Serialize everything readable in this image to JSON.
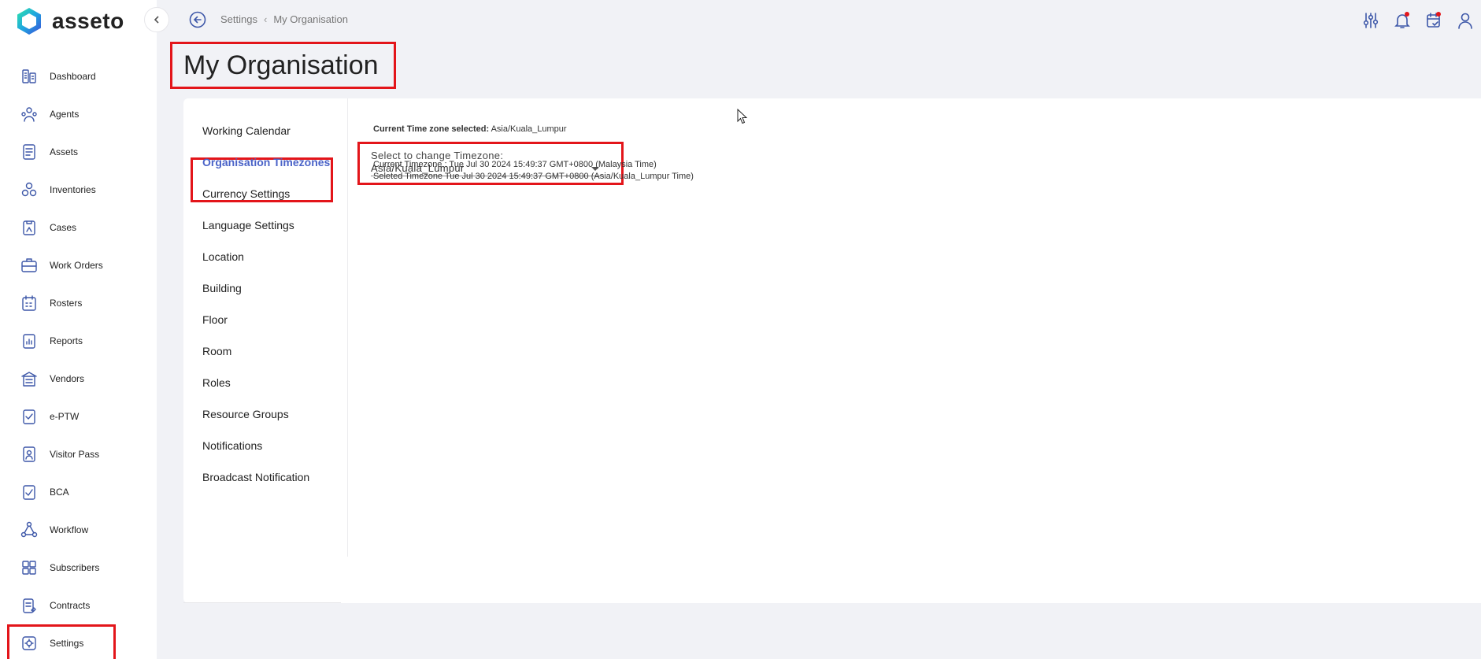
{
  "app": {
    "logo_text": "asseto",
    "brand_color": "#3d57a8",
    "highlight_color": "#e3151a"
  },
  "sidebar": {
    "items": [
      {
        "label": "Dashboard",
        "icon": "dashboard-icon"
      },
      {
        "label": "Agents",
        "icon": "agents-icon"
      },
      {
        "label": "Assets",
        "icon": "assets-icon"
      },
      {
        "label": "Inventories",
        "icon": "inventories-icon"
      },
      {
        "label": "Cases",
        "icon": "cases-icon"
      },
      {
        "label": "Work Orders",
        "icon": "work-orders-icon"
      },
      {
        "label": "Rosters",
        "icon": "rosters-icon"
      },
      {
        "label": "Reports",
        "icon": "reports-icon"
      },
      {
        "label": "Vendors",
        "icon": "vendors-icon"
      },
      {
        "label": "e-PTW",
        "icon": "eptw-icon"
      },
      {
        "label": "Visitor Pass",
        "icon": "visitor-pass-icon"
      },
      {
        "label": "BCA",
        "icon": "bca-icon"
      },
      {
        "label": "Workflow",
        "icon": "workflow-icon"
      },
      {
        "label": "Subscribers",
        "icon": "subscribers-icon"
      },
      {
        "label": "Contracts",
        "icon": "contracts-icon"
      },
      {
        "label": "Settings",
        "icon": "settings-icon"
      }
    ]
  },
  "breadcrumb": {
    "parent": "Settings",
    "current": "My Organisation"
  },
  "page": {
    "title": "My Organisation"
  },
  "settings_menu": {
    "items": [
      "Working Calendar",
      "Organisation Timezones",
      "Currency Settings",
      "Language Settings",
      "Location",
      "Building",
      "Floor",
      "Room",
      "Roles",
      "Resource Groups",
      "Notifications",
      "Broadcast Notification"
    ],
    "active": "Organisation Timezones"
  },
  "timezone": {
    "current_selected_label": "Current Time zone selected:",
    "current_selected_value": "Asia/Kuala_Lumpur",
    "select_label": "Select to change Timezone:",
    "select_value": "Asia/Kuala_Lumpur",
    "current_time_line": "Current Timezone : Tue Jul 30 2024 15:49:37 GMT+0800 (Malaysia Time)",
    "selected_time_line": "Seleted Timezone Tue Jul 30 2024 15:49:37 GMT+0800 (Asia/Kuala_Lumpur Time)"
  },
  "top_icons": [
    "filter-sliders-icon",
    "notification-bell-icon",
    "calendar-check-icon",
    "user-icon"
  ]
}
